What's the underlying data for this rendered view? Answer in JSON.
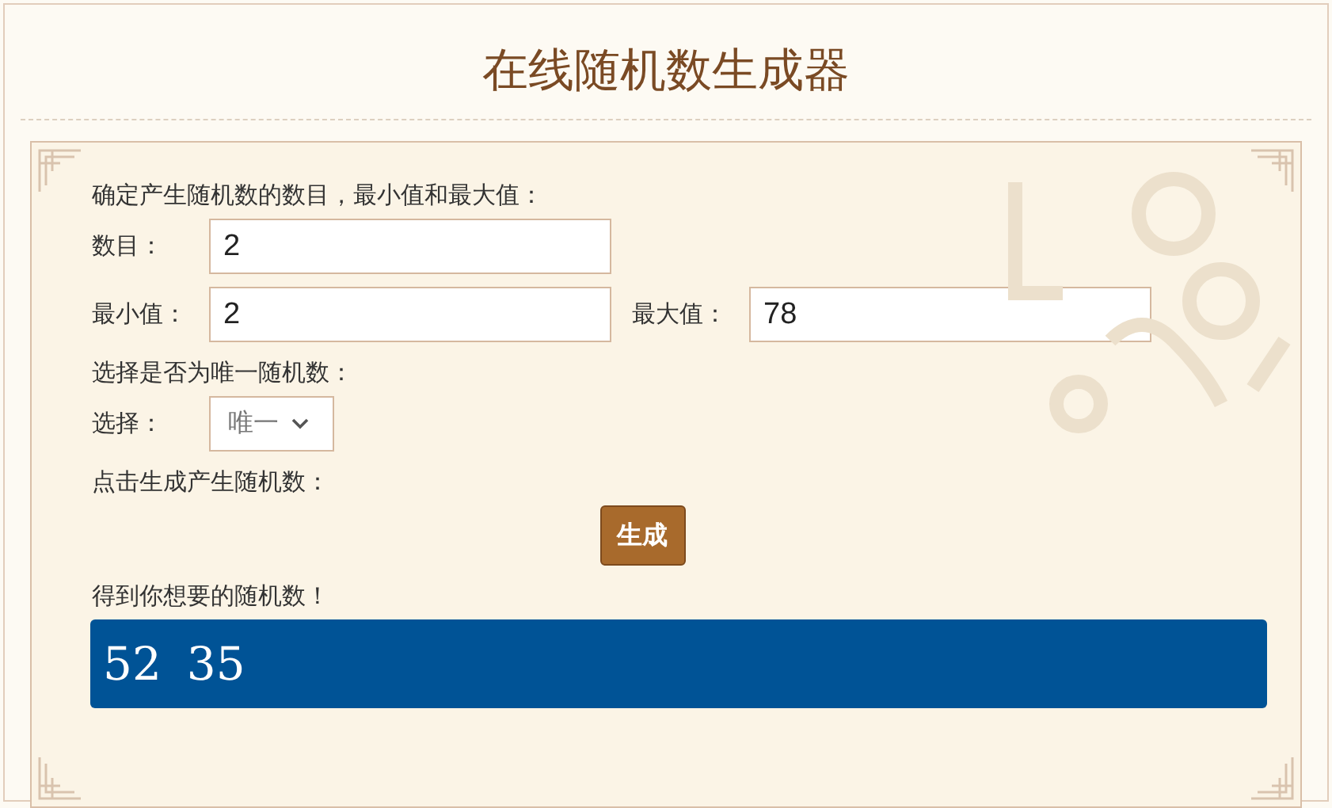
{
  "title": "在线随机数生成器",
  "intro": "确定产生随机数的数目，最小值和最大值：",
  "count": {
    "label": "数目：",
    "value": "2"
  },
  "min": {
    "label": "最小值：",
    "value": "2"
  },
  "max": {
    "label": "最大值：",
    "value": "78"
  },
  "unique_prompt": "选择是否为唯一随机数：",
  "choice": {
    "label": "选择：",
    "value": "唯一"
  },
  "generate_prompt": "点击生成产生随机数：",
  "generate_button": "生成",
  "result_label": "得到你想要的随机数！",
  "results": [
    "52",
    "35"
  ]
}
